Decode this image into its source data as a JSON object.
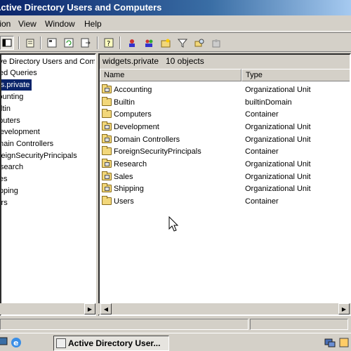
{
  "window": {
    "title": "Active Directory Users and Computers"
  },
  "menu": {
    "items": [
      "Action",
      "View",
      "Window",
      "Help"
    ]
  },
  "toolbar": {
    "icons": [
      "nav-icon",
      "delete-icon",
      "properties-icon",
      "refresh-icon",
      "export-icon",
      "help-icon",
      "new-user-icon",
      "new-group-icon",
      "new-ou-icon",
      "filter-icon",
      "find-icon",
      "add-to-group-icon"
    ]
  },
  "tree": {
    "items": [
      "Active Directory Users and Computers",
      "Saved Queries",
      "widgets.private",
      "Accounting",
      "Builtin",
      "Computers",
      "Development",
      "Domain Controllers",
      "ForeignSecurityPrincipals",
      "Research",
      "Sales",
      "Shipping",
      "Users"
    ],
    "selected_index": 2
  },
  "details": {
    "path": "widgets.private",
    "count": "10 objects",
    "columns": [
      "Name",
      "Type"
    ],
    "rows": [
      {
        "name": "Accounting",
        "type": "Organizational Unit",
        "icon": "ou-folder-icon"
      },
      {
        "name": "Builtin",
        "type": "builtinDomain",
        "icon": "folder-icon"
      },
      {
        "name": "Computers",
        "type": "Container",
        "icon": "folder-icon"
      },
      {
        "name": "Development",
        "type": "Organizational Unit",
        "icon": "ou-folder-icon"
      },
      {
        "name": "Domain Controllers",
        "type": "Organizational Unit",
        "icon": "ou-folder-icon"
      },
      {
        "name": "ForeignSecurityPrincipals",
        "type": "Container",
        "icon": "folder-icon"
      },
      {
        "name": "Research",
        "type": "Organizational Unit",
        "icon": "ou-folder-icon"
      },
      {
        "name": "Sales",
        "type": "Organizational Unit",
        "icon": "ou-folder-icon"
      },
      {
        "name": "Shipping",
        "type": "Organizational Unit",
        "icon": "ou-folder-icon"
      },
      {
        "name": "Users",
        "type": "Container",
        "icon": "folder-icon"
      }
    ]
  },
  "taskbar": {
    "active_task": "Active Directory User..."
  },
  "colors": {
    "title_start": "#0a246a",
    "title_end": "#a6caf0",
    "selection": "#0a246a",
    "chrome": "#d4d0c8",
    "folder": "#f2d77a"
  }
}
